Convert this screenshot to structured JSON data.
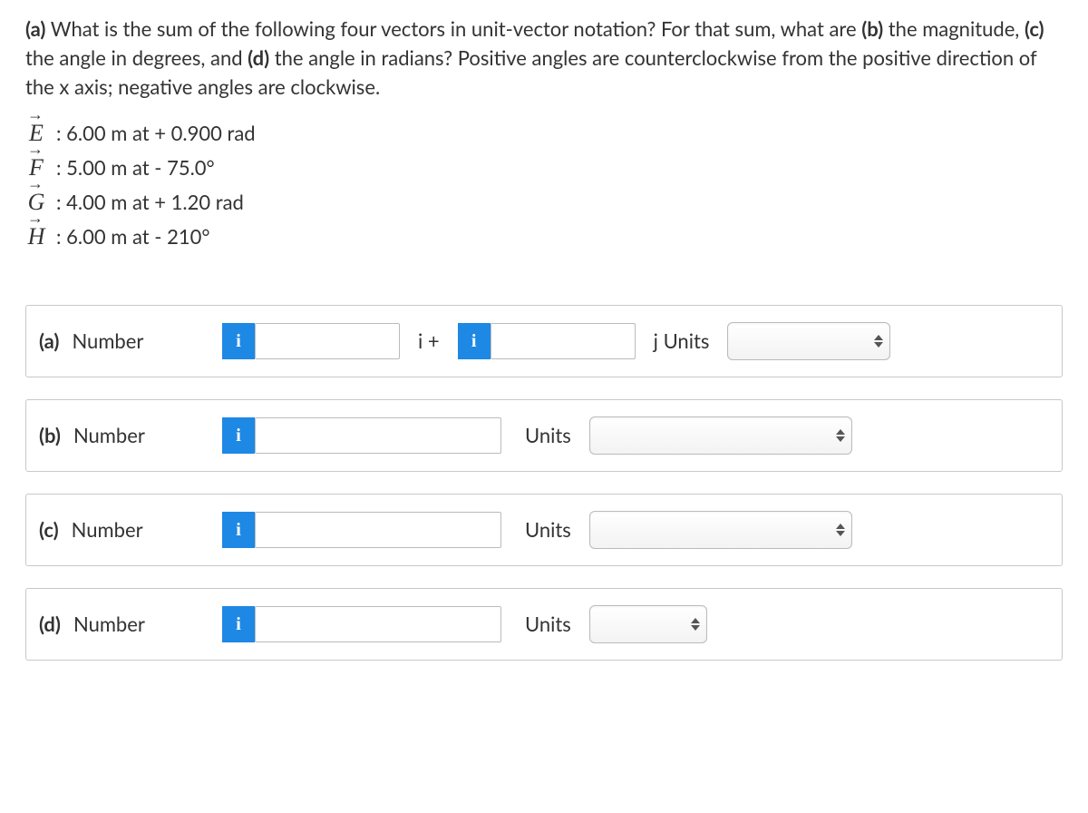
{
  "question": {
    "part_a_label": "(a)",
    "intro": " What is the sum of the following four vectors in unit-vector notation? For that sum, what are ",
    "part_b_label": "(b)",
    "mid1": " the magnitude, ",
    "part_c_label": "(c)",
    "mid2": " the angle in degrees, and ",
    "part_d_label": "(d)",
    "mid3": " the angle in radians? Positive angles are counterclockwise from the positive direction of the x axis; negative angles are clockwise."
  },
  "vectors": {
    "E": {
      "symbol": "E",
      "desc": ": 6.00 m at + 0.900 rad"
    },
    "F": {
      "symbol": "F",
      "desc": ": 5.00 m at - 75.0°"
    },
    "G": {
      "symbol": "G",
      "desc": ": 4.00 m at + 1.20 rad"
    },
    "H": {
      "symbol": "H",
      "desc": ": 6.00 m at - 210°"
    }
  },
  "labels": {
    "number": "Number",
    "units": "Units",
    "i_plus": "i +",
    "j_units": "j   Units",
    "info": "i"
  },
  "parts": {
    "a": "(a)",
    "b": "(b)",
    "c": "(c)",
    "d": "(d)"
  }
}
